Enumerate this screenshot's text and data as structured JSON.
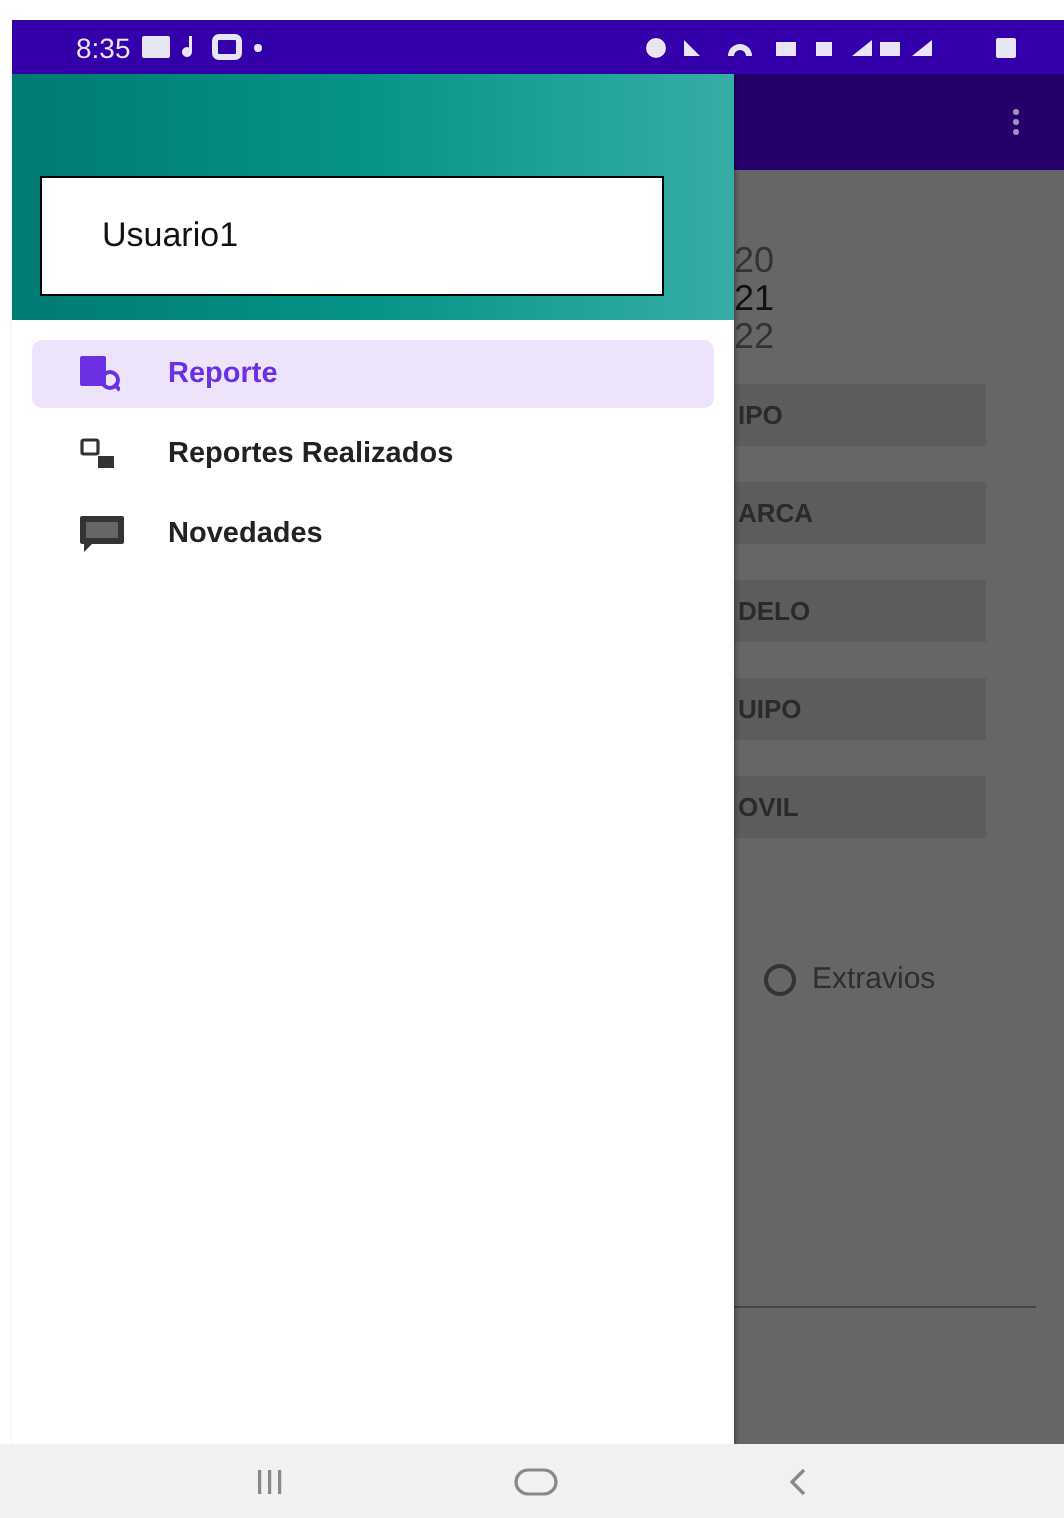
{
  "status_bar": {
    "time": "8:35"
  },
  "drawer": {
    "user": "Usuario1",
    "items": [
      {
        "label": "Reporte",
        "kind": "report",
        "selected": true
      },
      {
        "label": "Reportes Realizados",
        "kind": "list",
        "selected": false
      },
      {
        "label": "Novedades",
        "kind": "message",
        "selected": false
      }
    ]
  },
  "background_screen": {
    "years": [
      {
        "text": "20",
        "selected": false
      },
      {
        "text": "21",
        "selected": true
      },
      {
        "text": "22",
        "selected": false
      }
    ],
    "buttons": [
      "IPO",
      "ARCA",
      "DELO",
      "UIPO",
      "OVIL"
    ],
    "radio": {
      "label": "Extravios",
      "selected": false
    }
  }
}
